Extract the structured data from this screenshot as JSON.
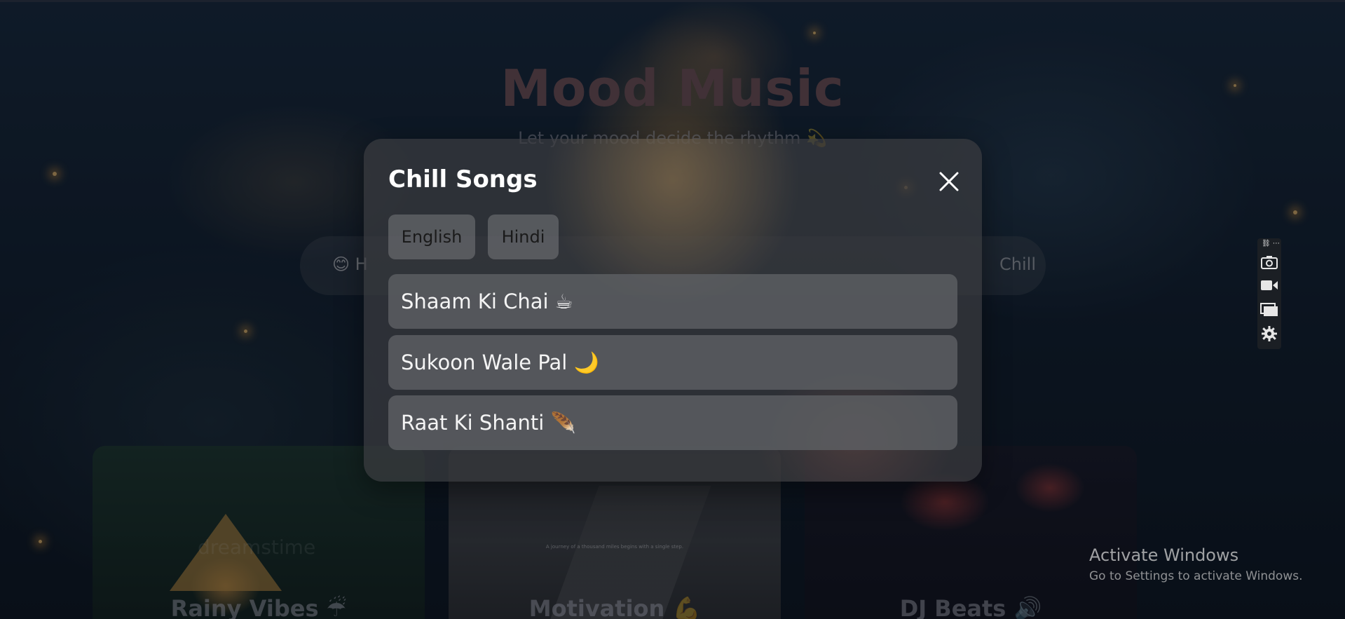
{
  "page": {
    "hero_title": "Mood Music",
    "hero_subtitle": "Let your mood decide the rhythm 💫",
    "mood_bar": {
      "left_label": "😊 H",
      "right_label": "Chill"
    }
  },
  "cards": [
    {
      "label": "Rainy Vibes ☔",
      "watermark": "dreamstime"
    },
    {
      "label": "Motivation 💪",
      "caption": "A journey of a thousand miles begins with a single step."
    },
    {
      "label": "DJ Beats 🔊"
    }
  ],
  "modal": {
    "title": "Chill Songs",
    "language_buttons": [
      "English",
      "Hindi"
    ],
    "songs": [
      "Shaam Ki Chai ☕",
      "Sukoon Wale Pal 🌙",
      "Raat Ki Shanti 🪶"
    ]
  },
  "toolbar": {
    "icons": [
      "link-more-icon",
      "camera-icon",
      "video-icon",
      "window-icon",
      "gear-icon"
    ],
    "mini_glyph": "⛓ ⋯"
  },
  "os_overlay": {
    "activate_title": "Activate Windows",
    "activate_subtitle": "Go to Settings to activate Windows."
  },
  "colors": {
    "hero_title": "#6e4d50",
    "modal_bg": "#3a3c40",
    "song_row_bg": "#5f6165",
    "lang_button_bg": "#787a7e"
  }
}
